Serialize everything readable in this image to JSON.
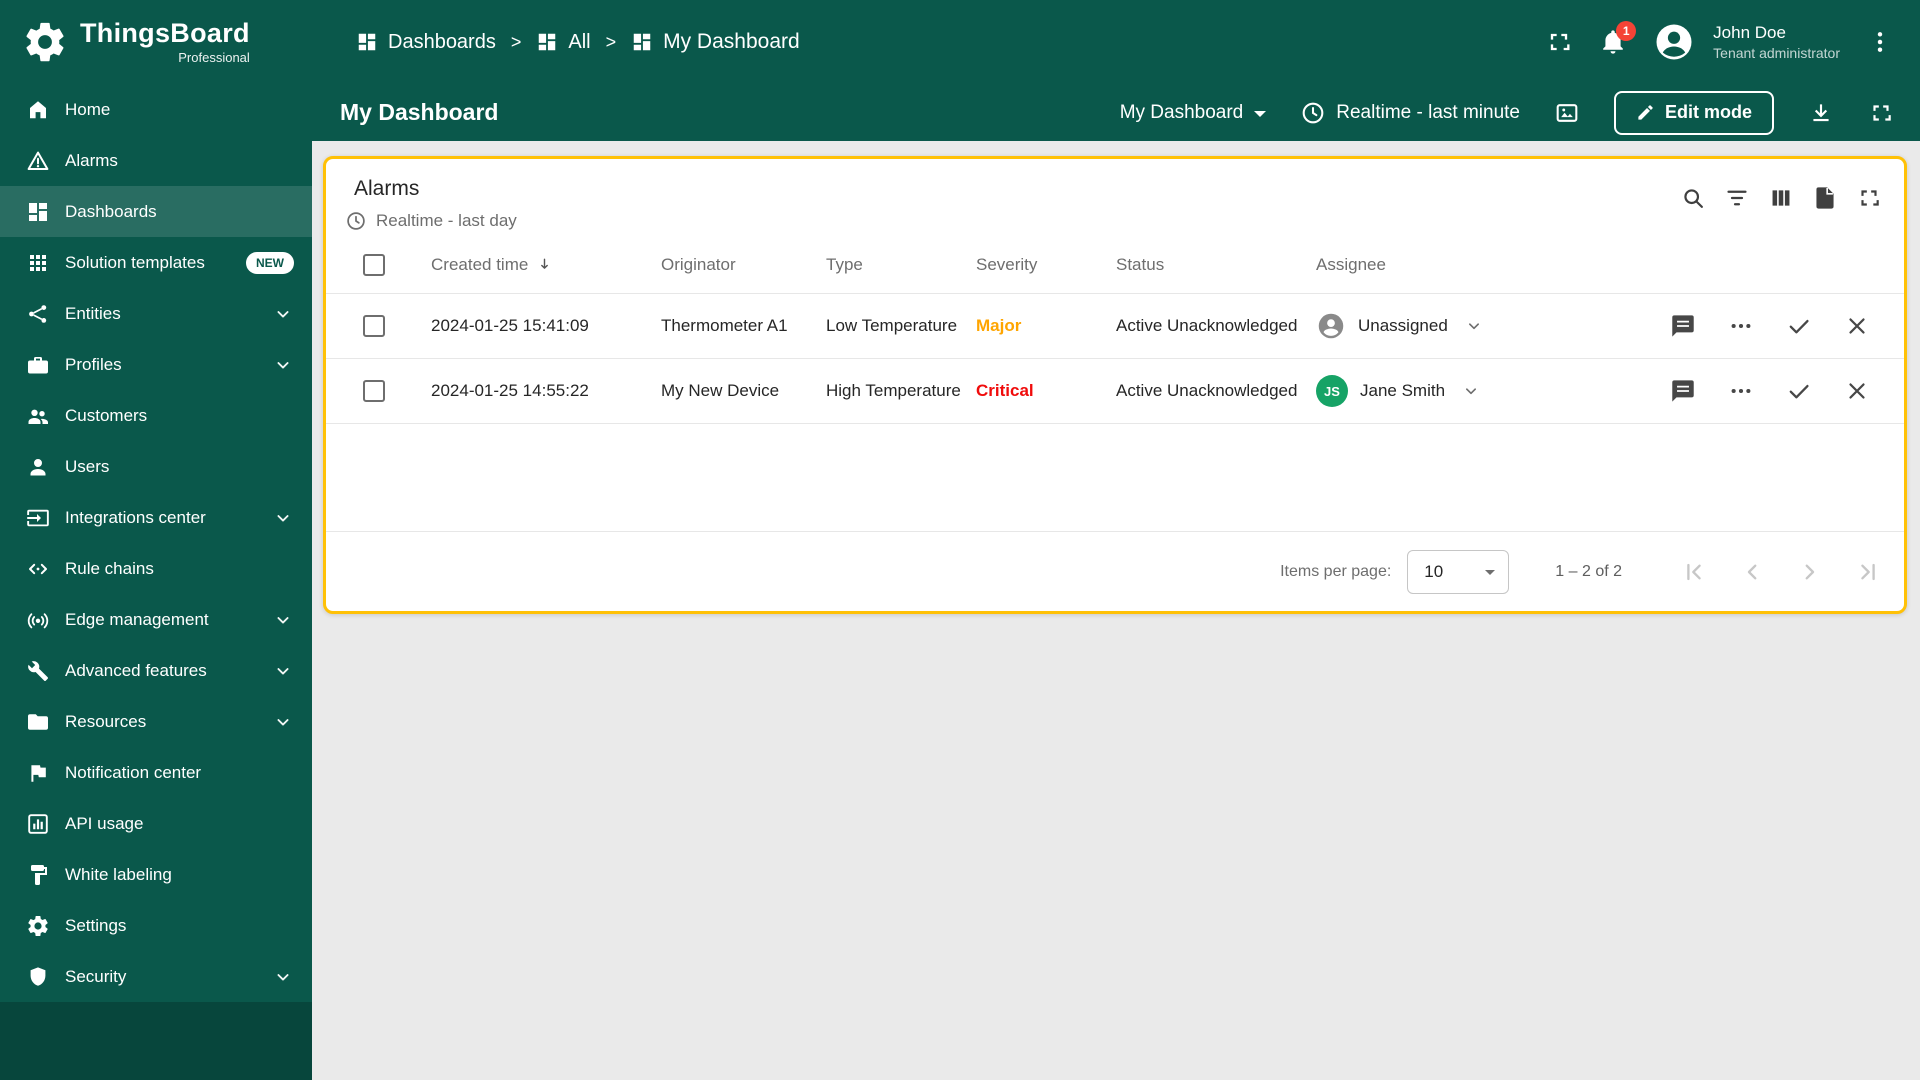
{
  "brand": {
    "name": "ThingsBoard",
    "sub": "Professional"
  },
  "sidebar": {
    "items": [
      {
        "label": "Home"
      },
      {
        "label": "Alarms"
      },
      {
        "label": "Dashboards",
        "active": true
      },
      {
        "label": "Solution templates",
        "badge": "NEW"
      },
      {
        "label": "Entities",
        "expandable": true
      },
      {
        "label": "Profiles",
        "expandable": true
      },
      {
        "label": "Customers"
      },
      {
        "label": "Users"
      },
      {
        "label": "Integrations center",
        "expandable": true
      },
      {
        "label": "Rule chains"
      },
      {
        "label": "Edge management",
        "expandable": true
      },
      {
        "label": "Advanced features",
        "expandable": true
      },
      {
        "label": "Resources",
        "expandable": true
      },
      {
        "label": "Notification center"
      },
      {
        "label": "API usage"
      },
      {
        "label": "White labeling"
      },
      {
        "label": "Settings"
      },
      {
        "label": "Security",
        "expandable": true
      }
    ]
  },
  "breadcrumb": {
    "separator": ">",
    "items": [
      "Dashboards",
      "All",
      "My Dashboard"
    ]
  },
  "header": {
    "notification_count": "1",
    "user": {
      "name": "John Doe",
      "role": "Tenant administrator"
    }
  },
  "toolbar": {
    "title": "My Dashboard",
    "state_label": "My Dashboard",
    "time_label": "Realtime - last minute",
    "edit_label": "Edit mode"
  },
  "widget": {
    "title": "Alarms",
    "subtitle": "Realtime - last day",
    "columns": [
      "Created time",
      "Originator",
      "Type",
      "Severity",
      "Status",
      "Assignee"
    ],
    "rows": [
      {
        "created": "2024-01-25 15:41:09",
        "originator": "Thermometer A1",
        "type": "Low Temperature",
        "severity": "Major",
        "status": "Active Unacknowledged",
        "assignee": "Unassigned"
      },
      {
        "created": "2024-01-25 14:55:22",
        "originator": "My New Device",
        "type": "High Temperature",
        "severity": "Critical",
        "status": "Active Unacknowledged",
        "assignee": "Jane Smith",
        "assignee_initials": "JS"
      }
    ],
    "footer": {
      "items_per_page_label": "Items per page:",
      "page_size": "10",
      "range": "1 – 2 of 2"
    }
  },
  "colors": {
    "sidebar_green": "#0a584b",
    "accent_amber": "#ffc107",
    "severity_major": "#ffa500",
    "severity_critical": "#f00c0c",
    "assignee_avatar_green": "#16a366",
    "notification_badge_red": "#f44336"
  }
}
